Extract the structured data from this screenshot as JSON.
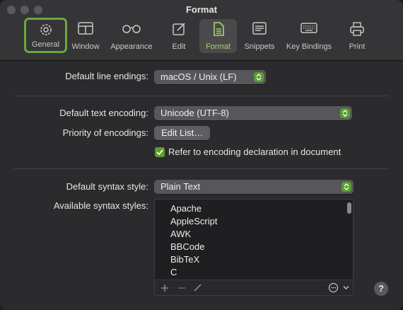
{
  "window": {
    "title": "Format"
  },
  "toolbar": {
    "items": [
      {
        "label": "General",
        "icon": "gear-icon"
      },
      {
        "label": "Window",
        "icon": "window-icon"
      },
      {
        "label": "Appearance",
        "icon": "glasses-icon"
      },
      {
        "label": "Edit",
        "icon": "edit-icon"
      },
      {
        "label": "Format",
        "icon": "document-icon"
      },
      {
        "label": "Snippets",
        "icon": "snippets-icon"
      },
      {
        "label": "Key Bindings",
        "icon": "keyboard-icon"
      },
      {
        "label": "Print",
        "icon": "printer-icon"
      }
    ]
  },
  "line_endings": {
    "label": "Default line endings:",
    "value": "macOS / Unix (LF)"
  },
  "encoding": {
    "label": "Default text encoding:",
    "value": "Unicode (UTF-8)",
    "priority_label": "Priority of encodings:",
    "edit_list_label": "Edit List…",
    "refer_label": "Refer to encoding declaration in document",
    "refer_checked": true
  },
  "syntax": {
    "label": "Default syntax style:",
    "value": "Plain Text",
    "available_label": "Available syntax styles:",
    "styles": [
      "Apache",
      "AppleScript",
      "AWK",
      "BBCode",
      "BibTeX",
      "C"
    ]
  },
  "help": {
    "label": "?"
  },
  "colors": {
    "accent": "#5a9e2f",
    "selected_text": "#a6d86a",
    "highlight_border": "#69a83b"
  }
}
